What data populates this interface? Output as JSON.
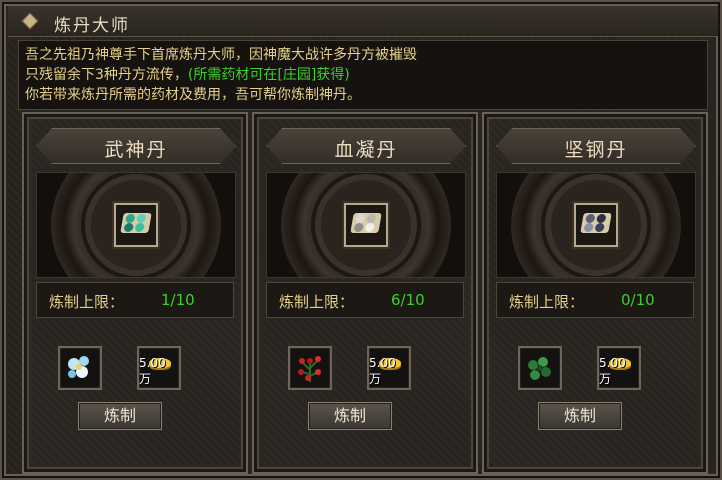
{
  "window": {
    "title": "炼丹大师"
  },
  "description": {
    "line1": "吾之先祖乃神尊手下首席炼丹大师，因神魔大战许多丹方被摧毁",
    "line2_prefix": "只残留余下3种丹方流传，",
    "line2_highlight": "(所需药材可在[庄园]获得)",
    "line3": "你若带来炼丹所需的药材及费用，吾可帮你炼制神丹。"
  },
  "cards": [
    {
      "name": "武神丹",
      "limit_label": "炼制上限：",
      "limit_value": "1/10",
      "price": "5.00万",
      "button": "炼制",
      "pill_colors": [
        "#2aa88a",
        "#5fcfc0",
        "#1d7b6b",
        "#3bbfa3"
      ]
    },
    {
      "name": "血凝丹",
      "limit_label": "炼制上限：",
      "limit_value": "6/10",
      "price": "5.00万",
      "button": "炼制",
      "pill_colors": [
        "#d9d9d4",
        "#b9b9b2",
        "#8e8e86",
        "#eeeeea"
      ]
    },
    {
      "name": "坚钢丹",
      "limit_label": "炼制上限：",
      "limit_value": "0/10",
      "price": "5.00万",
      "button": "炼制",
      "pill_colors": [
        "#5a5f7c",
        "#2a2f44",
        "#8a8fa8",
        "#3c405a"
      ]
    }
  ]
}
